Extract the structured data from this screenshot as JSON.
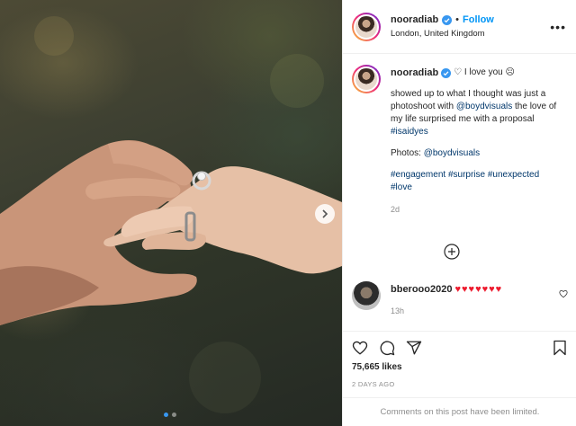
{
  "header": {
    "username": "nooradiab",
    "follow_label": "Follow",
    "bullet": "•",
    "location": "London, United Kingdom",
    "more_label": "•••"
  },
  "caption": {
    "username": "nooradiab",
    "first_line": "♡ I love you ☹",
    "line_a": "showed up to what I thought was just a photoshoot with ",
    "mention_1": "@boydvisuals",
    "line_b": " the love of my life surprised me with a proposal ",
    "hashtag_isaidyes": "#isaidyes",
    "photos_label": "Photos: ",
    "mention_2": "@boydvisuals",
    "hashtags": [
      "#engagement",
      "#surprise",
      "#unexpected",
      "#love"
    ],
    "time": "2d"
  },
  "comments": [
    {
      "username": "bberooo2020",
      "text": "♥♥♥♥♥♥♥",
      "time": "13h"
    }
  ],
  "actions": {
    "likes": "75,665 likes",
    "date": "2 DAYS AGO"
  },
  "footer": {
    "limited_text": "Comments on this post have been limited."
  },
  "carousel": {
    "slide_count": 2,
    "active_index": 0
  },
  "colors": {
    "link": "#00376b",
    "follow": "#0095f6",
    "verified": "#3897f0",
    "muted": "#8e8e8e",
    "heart": "#ed1b2e"
  }
}
